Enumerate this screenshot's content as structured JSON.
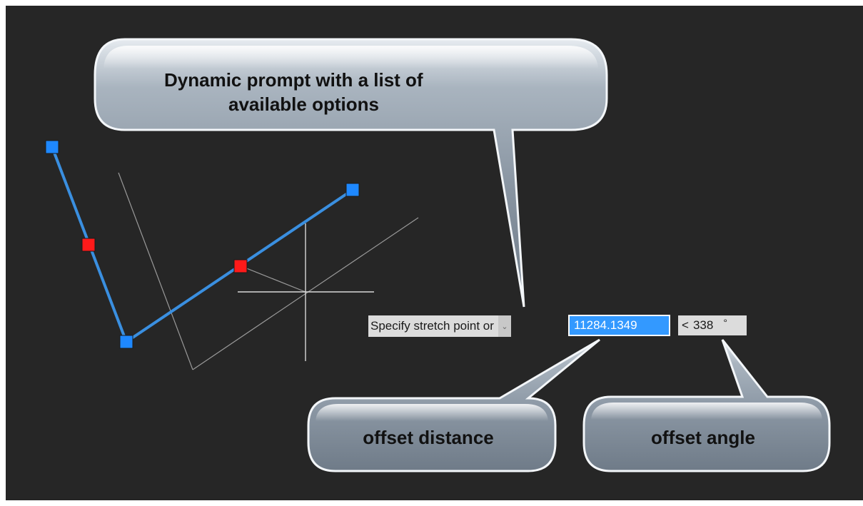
{
  "callouts": {
    "prompt_line1": "Dynamic prompt with a list of",
    "prompt_line2": "available options",
    "offset_distance": "offset distance",
    "offset_angle": "offset angle"
  },
  "dynamic_input": {
    "prompt_label": "Specify stretch point or",
    "dropdown_arrow": "⌄",
    "distance_value": "11284.1349",
    "angle_prefix": "<",
    "angle_value": "338",
    "angle_unit": "°"
  },
  "colors": {
    "viewport_bg": "#262626",
    "polyline": "#3a8fe0",
    "grip_endpoint": "#1e88ff",
    "grip_midpoint": "#ff1a1a",
    "construction_line": "#9a9a9a",
    "crosshair": "#d8d8d8",
    "distance_field": "#3399ff",
    "callout_fill": "#8c99a6"
  },
  "icons": {
    "dropdown": "chevron-down-icon"
  }
}
